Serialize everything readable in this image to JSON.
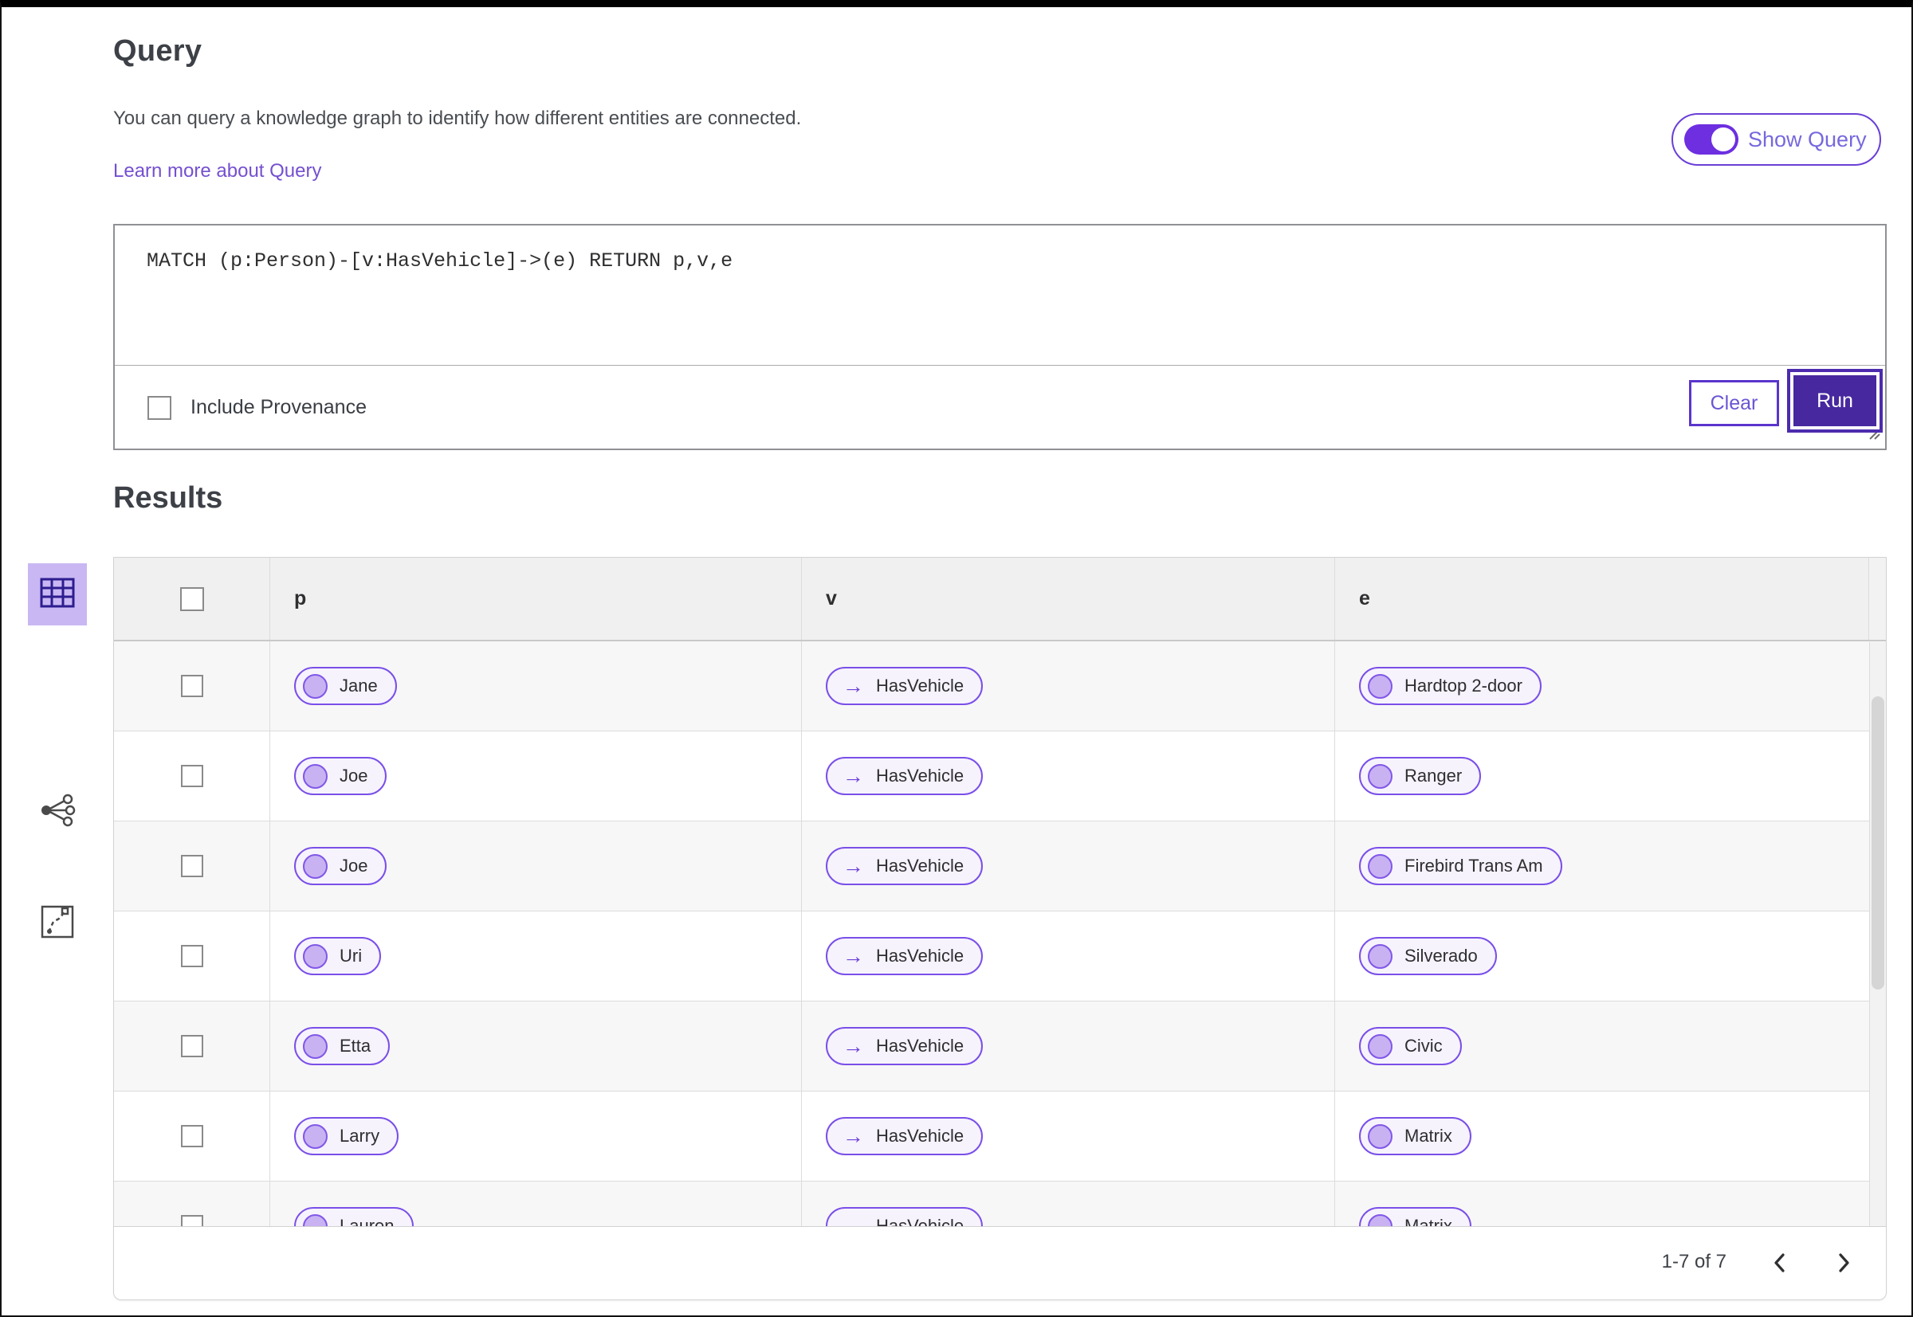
{
  "header": {
    "title": "Query",
    "description": "You can query a knowledge graph to identify how different entities are connected.",
    "learn_more_link": "Learn more about Query",
    "show_query_label": "Show Query",
    "show_query_state": "on"
  },
  "query_panel": {
    "query_text": "MATCH (p:Person)-[v:HasVehicle]->(e) RETURN p,v,e",
    "include_provenance_label": "Include Provenance",
    "include_provenance_checked": false,
    "clear_button": "Clear",
    "run_button": "Run"
  },
  "results": {
    "title": "Results",
    "views": [
      {
        "id": "table-view",
        "selected": true
      },
      {
        "id": "graph-view",
        "selected": false
      },
      {
        "id": "route-view",
        "selected": false
      }
    ],
    "columns": [
      "p",
      "v",
      "e"
    ],
    "relation_arrow": "→",
    "rows": [
      {
        "p": "Jane",
        "v": "HasVehicle",
        "e": "Hardtop 2-door"
      },
      {
        "p": "Joe",
        "v": "HasVehicle",
        "e": "Ranger"
      },
      {
        "p": "Joe",
        "v": "HasVehicle",
        "e": "Firebird Trans Am"
      },
      {
        "p": "Uri",
        "v": "HasVehicle",
        "e": "Silverado"
      },
      {
        "p": "Etta",
        "v": "HasVehicle",
        "e": "Civic"
      },
      {
        "p": "Larry",
        "v": "HasVehicle",
        "e": "Matrix"
      },
      {
        "p": "Lauren",
        "v": "HasVehicle",
        "e": "Matrix"
      }
    ],
    "pagination": {
      "range_label": "1-7 of 7"
    }
  },
  "colors": {
    "accent_purple": "#6d3fd8",
    "deep_purple": "#47289f",
    "pill_border": "#7a4fe8",
    "pill_fill": "#f6f3fd",
    "selected_view_bg": "#c8b7f3",
    "link_purple": "#7450d0"
  }
}
